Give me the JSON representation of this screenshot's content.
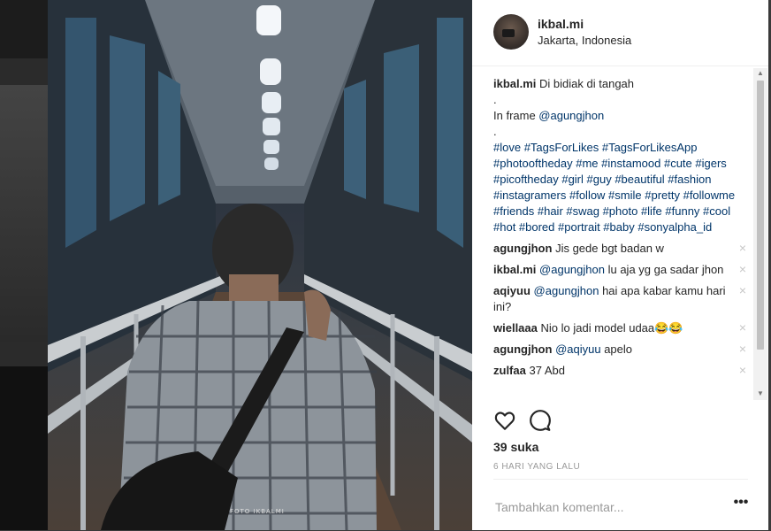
{
  "post": {
    "username": "ikbal.mi",
    "location": "Jakarta, Indonesia",
    "watermark": "FOTO IKBALMI"
  },
  "caption": {
    "username": "ikbal.mi",
    "text": "Di bidiak di tangah",
    "dot1": ".",
    "in_frame_prefix": "In frame ",
    "in_frame_mention": "@agungjhon",
    "dot2": ".",
    "hashtags": "#love #TagsForLikes #TagsForLikesApp #photooftheday #me #instamood #cute #igers #picoftheday #girl #guy #beautiful #fashion #instagramers #follow #smile #pretty #followme #friends #hair #swag #photo #life #funny #cool #hot #bored #portrait #baby #sonyalpha_id"
  },
  "comments": [
    {
      "user": "agungjhon",
      "mention": "",
      "text": "Jis gede bgt badan w"
    },
    {
      "user": "ikbal.mi",
      "mention": "@agungjhon",
      "text": " lu aja yg ga sadar jhon"
    },
    {
      "user": "aqiyuu",
      "mention": "@agungjhon",
      "text": " hai apa kabar kamu hari ini?"
    },
    {
      "user": "wiellaaa",
      "mention": "",
      "text": "Nio lo jadi model udaa😂😂"
    },
    {
      "user": "agungjhon",
      "mention": "@aqiyuu",
      "text": " apelo"
    },
    {
      "user": "zulfaa",
      "mention": "",
      "text": "37 Abd"
    }
  ],
  "remove_icon": "×",
  "actions": {
    "like_icon": "heart-icon",
    "comment_icon": "comment-icon"
  },
  "likes": "39 suka",
  "timestamp": "6 HARI YANG LALU",
  "add_comment": {
    "placeholder": "Tambahkan komentar...",
    "more": "•••"
  },
  "scroll": {
    "up": "▲",
    "down": "▼"
  }
}
